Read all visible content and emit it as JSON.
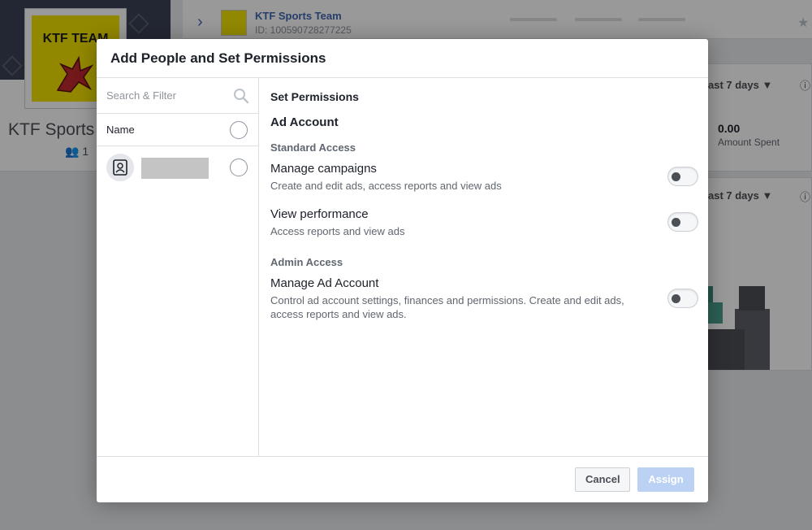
{
  "background": {
    "logo_text": "KTF TEAM",
    "page_name": "KTF Sports",
    "member_count": "1",
    "account_name": "KTF Sports Team",
    "account_id": "ID: 100590728277225",
    "date_range_1": "ast 7 days",
    "date_range_2": "ast 7 days",
    "amount_value": "0.00",
    "amount_label": "Amount Spent"
  },
  "modal": {
    "title": "Add People and Set Permissions",
    "search": {
      "placeholder": "Search & Filter"
    },
    "name_header": "Name",
    "set_permissions_heading": "Set Permissions",
    "account_heading": "Ad Account",
    "groups": [
      {
        "heading": "Standard Access",
        "permissions": [
          {
            "title": "Manage campaigns",
            "description": "Create and edit ads, access reports and view ads",
            "enabled": false
          },
          {
            "title": "View performance",
            "description": "Access reports and view ads",
            "enabled": false
          }
        ]
      },
      {
        "heading": "Admin Access",
        "permissions": [
          {
            "title": "Manage Ad Account",
            "description": "Control ad account settings, finances and permissions. Create and edit ads, access reports and view ads.",
            "enabled": false
          }
        ]
      }
    ],
    "cancel_label": "Cancel",
    "assign_label": "Assign"
  },
  "colors": {
    "link_blue": "#4267b2",
    "assign_disabled": "#bcd2f5",
    "logo_yellow": "#f3e300"
  }
}
